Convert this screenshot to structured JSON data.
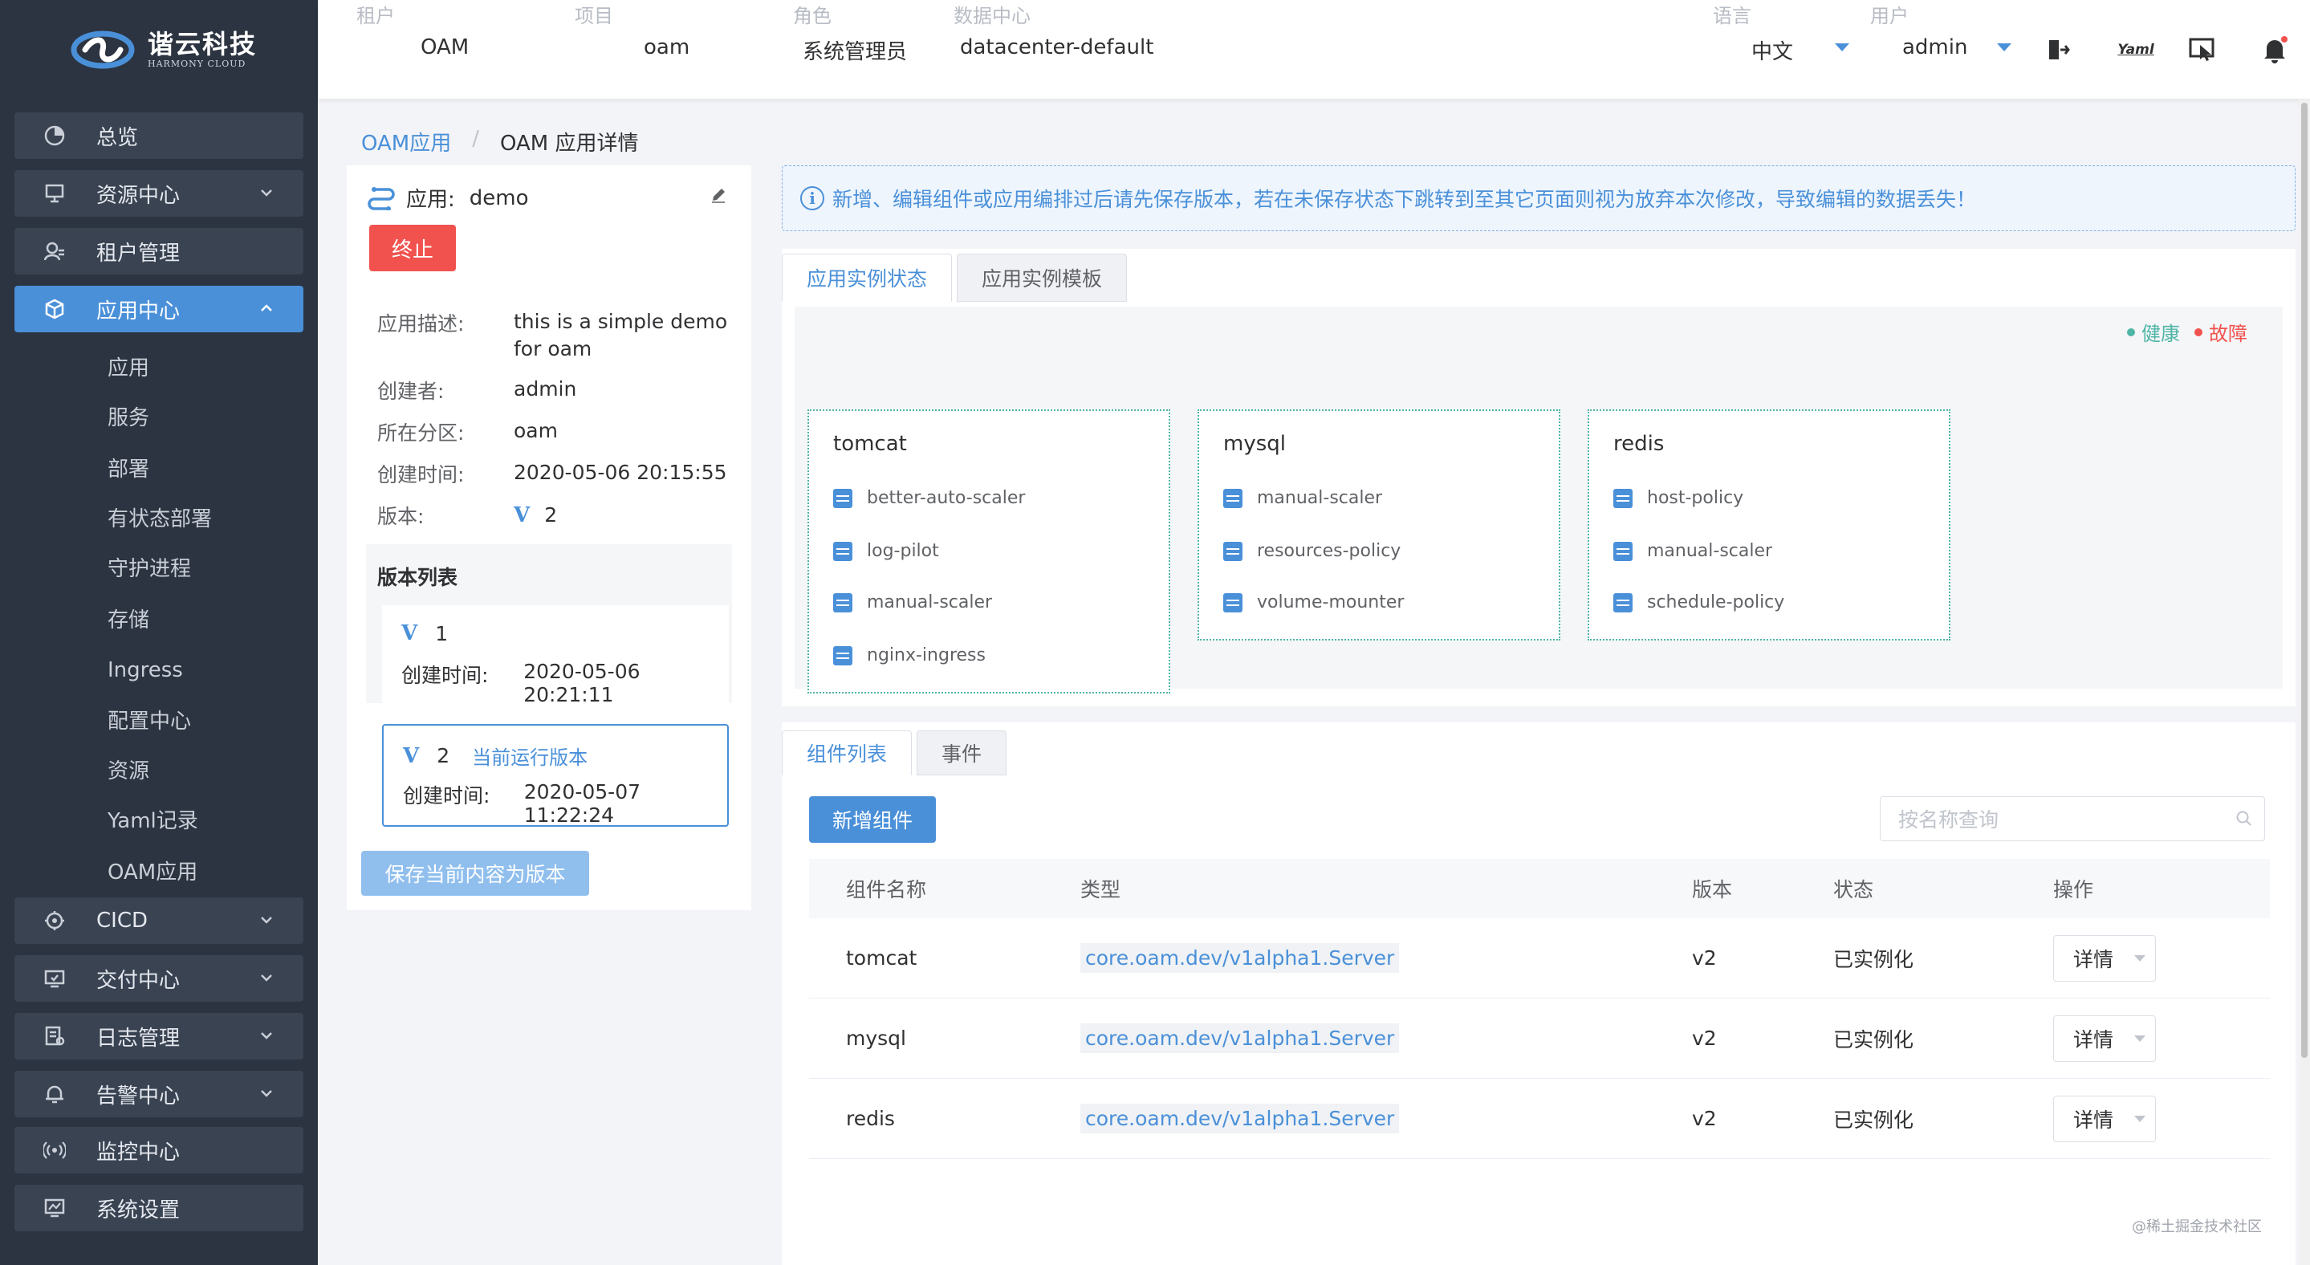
{
  "brand": {
    "name": "谐云科技",
    "sub": "HARMONY CLOUD"
  },
  "sidebar": {
    "items": [
      {
        "label": "总览",
        "icon": "dashboard-icon"
      },
      {
        "label": "资源中心",
        "icon": "resource-icon"
      },
      {
        "label": "租户管理",
        "icon": "tenant-icon"
      },
      {
        "label": "应用中心",
        "icon": "app-center-icon"
      },
      {
        "label": "CICD",
        "icon": "cicd-icon"
      },
      {
        "label": "交付中心",
        "icon": "delivery-icon"
      },
      {
        "label": "日志管理",
        "icon": "log-icon"
      },
      {
        "label": "告警中心",
        "icon": "alarm-icon"
      },
      {
        "label": "监控中心",
        "icon": "monitor-icon"
      },
      {
        "label": "系统设置",
        "icon": "settings-icon"
      }
    ],
    "submenu": [
      "应用",
      "服务",
      "部署",
      "有状态部署",
      "守护进程",
      "存储",
      "Ingress",
      "配置中心",
      "资源",
      "Yaml记录",
      "OAM应用"
    ]
  },
  "header": {
    "tenant": {
      "label": "租户",
      "value": "OAM"
    },
    "project": {
      "label": "项目",
      "value": "oam"
    },
    "role": {
      "label": "角色",
      "value": "系统管理员"
    },
    "datacenter": {
      "label": "数据中心",
      "value": "datacenter-default"
    },
    "language": {
      "label": "语言",
      "value": "中文"
    },
    "user": {
      "label": "用户",
      "value": "admin"
    },
    "yaml_icon_text": "Yaml"
  },
  "breadcrumb": {
    "link": "OAM应用",
    "sep": "/",
    "current": "OAM 应用详情"
  },
  "app": {
    "label": "应用:",
    "name": "demo",
    "stop_label": "终止",
    "info": [
      {
        "k": "应用描述:",
        "v": "this is a simple demo for oam"
      },
      {
        "k": "创建者:",
        "v": "admin"
      },
      {
        "k": "所在分区:",
        "v": "oam"
      },
      {
        "k": "创建时间:",
        "v": "2020-05-06 20:15:55"
      },
      {
        "k": "版本:",
        "v": "2"
      }
    ],
    "version_badge": "V",
    "versions_title": "版本列表",
    "versions": [
      {
        "num": "1",
        "time_label": "创建时间:",
        "time": "2020-05-06 20:21:11",
        "current": ""
      },
      {
        "num": "2",
        "time_label": "创建时间:",
        "time": "2020-05-07 11:22:24",
        "current": "当前运行版本"
      }
    ],
    "save_label": "保存当前内容为版本"
  },
  "notice": {
    "icon": "i",
    "text": "新增、编辑组件或应用编排过后请先保存版本，若在未保存状态下跳转到至其它页面则视为放弃本次修改，导致编辑的数据丢失！"
  },
  "instance_tabs": [
    "应用实例状态",
    "应用实例模板"
  ],
  "legend": {
    "healthy": "健康",
    "fault": "故障",
    "healthy_color": "#4fb5a6",
    "fault_color": "#f1524e"
  },
  "components": [
    {
      "name": "tomcat",
      "traits": [
        "better-auto-scaler",
        "log-pilot",
        "manual-scaler",
        "nginx-ingress"
      ]
    },
    {
      "name": "mysql",
      "traits": [
        "manual-scaler",
        "resources-policy",
        "volume-mounter"
      ]
    },
    {
      "name": "redis",
      "traits": [
        "host-policy",
        "manual-scaler",
        "schedule-policy"
      ]
    }
  ],
  "list_tabs": [
    "组件列表",
    "事件"
  ],
  "add_label": "新增组件",
  "search_placeholder": "按名称查询",
  "table": {
    "columns": [
      "组件名称",
      "类型",
      "版本",
      "状态",
      "操作"
    ],
    "rows": [
      {
        "name": "tomcat",
        "type": "core.oam.dev/v1alpha1.Server",
        "version": "v2",
        "status": "已实例化",
        "action": "详情"
      },
      {
        "name": "mysql",
        "type": "core.oam.dev/v1alpha1.Server",
        "version": "v2",
        "status": "已实例化",
        "action": "详情"
      },
      {
        "name": "redis",
        "type": "core.oam.dev/v1alpha1.Server",
        "version": "v2",
        "status": "已实例化",
        "action": "详情"
      }
    ]
  },
  "watermark": "@稀土掘金技术社区",
  "colors": {
    "accent": "#4a90d9",
    "sidebar": "#2c3441",
    "danger": "#f1524e"
  }
}
